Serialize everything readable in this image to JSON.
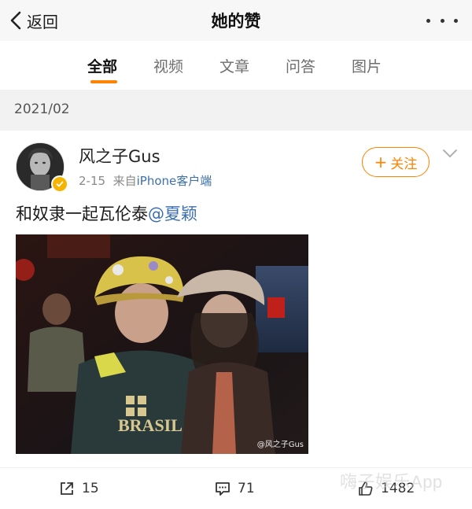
{
  "topbar": {
    "back_label": "返回",
    "title": "她的赞"
  },
  "tabs": [
    {
      "label": "全部",
      "active": true
    },
    {
      "label": "视频",
      "active": false
    },
    {
      "label": "文章",
      "active": false
    },
    {
      "label": "问答",
      "active": false
    },
    {
      "label": "图片",
      "active": false
    }
  ],
  "date_header": "2021/02",
  "post": {
    "username": "风之子Gus",
    "date": "2-15",
    "source_prefix": "来自",
    "source_device": "iPhone客户端",
    "follow_label": "关注",
    "text": "和奴隶一起瓦伦泰",
    "mention": "@夏颖",
    "image_watermark": "@风之子Gus",
    "image_jersey_text": "BRASIL"
  },
  "actions": {
    "repost_count": "15",
    "comment_count": "71",
    "like_count": "1482"
  },
  "overlay_watermark": {
    "text_cn": "嗨子娱乐",
    "text_latin": "App"
  },
  "colors": {
    "accent": "#ff8200",
    "link": "#3c6fb0",
    "verified": "#f6b400"
  }
}
